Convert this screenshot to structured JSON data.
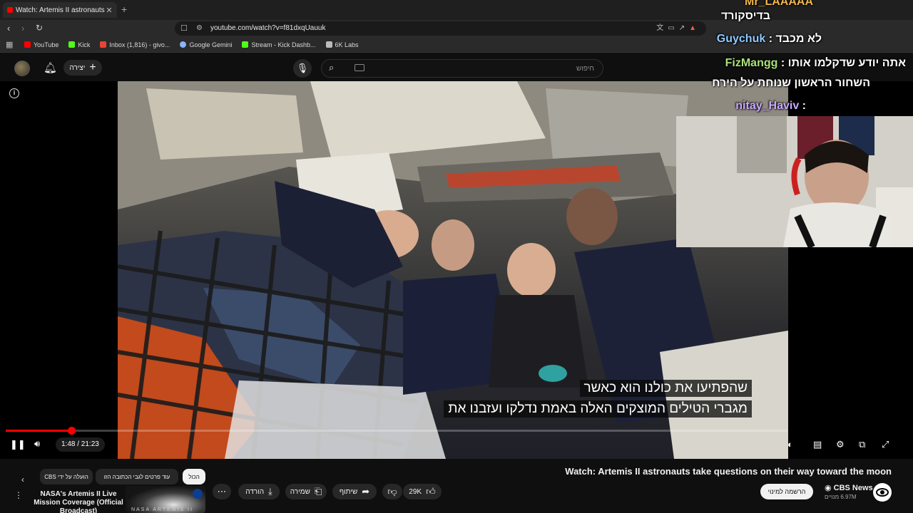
{
  "browser": {
    "tab_title": "Watch: Artemis II astronauts",
    "url": "youtube.com/watch?v=f81dxqUauuk",
    "bookmarks": [
      {
        "label": "YouTube",
        "color": "#ff0000"
      },
      {
        "label": "Kick",
        "color": "#53fc18"
      },
      {
        "label": "Inbox (1,816) - givo...",
        "color": "#ea4335"
      },
      {
        "label": "Google Gemini",
        "color": "#8ab4f8"
      },
      {
        "label": "Stream - Kick Dashb...",
        "color": "#53fc18"
      },
      {
        "label": "6K Labs",
        "color": "#bbbbbb"
      }
    ]
  },
  "masthead": {
    "create_label": "יצירה",
    "search_placeholder": "חיפוש"
  },
  "player": {
    "subtitle_line1": "שהפתיעו את כולנו הוא כאשר",
    "subtitle_line2": "מגברי הטילים המוצקים האלה באמת נדלקו ועזבנו את",
    "current_time": "1:48",
    "duration": "21:23",
    "time_display": "1:48 / 21:23",
    "progress_fraction": 0.0842,
    "accent_color": "#ff0000"
  },
  "overlay": {
    "chat_top_partial": "בדיסקורד",
    "chat_top_cut": "Mr_LAAAAA",
    "chat": [
      {
        "user": "Guychuk",
        "message": "לא מכבד",
        "user_color": "blue"
      },
      {
        "user": "FizMangg",
        "message": "אתה יודע שדקלמו אותו",
        "user_color": "green"
      },
      {
        "user": "",
        "message": "השחור הראשון שנוחת על הירח",
        "user_color": "green"
      },
      {
        "user": "nitay_Haviv",
        "message": "",
        "user_color": "purple"
      }
    ]
  },
  "video": {
    "title": "Watch: Artemis II astronauts take questions on their way toward the moon",
    "channel_name": "CBS News",
    "subscribers": "6.97M מנויים",
    "subscribe_label": "הרשמה למינוי",
    "like_count": "29K",
    "share_label": "שיתוף",
    "save_label": "שמירה",
    "download_label": "הורדה"
  },
  "chips": {
    "all_label": "הכול",
    "chip2_label": "עוד פרטים לגבי הכתובה הזו",
    "chip3_label": "הועלה על ידי CBS"
  },
  "recommendation": {
    "title": "NASA's Artemis II Live Mission Coverage (Official Broadcast)",
    "thumb_text": "NASA ARTEMIS II"
  }
}
